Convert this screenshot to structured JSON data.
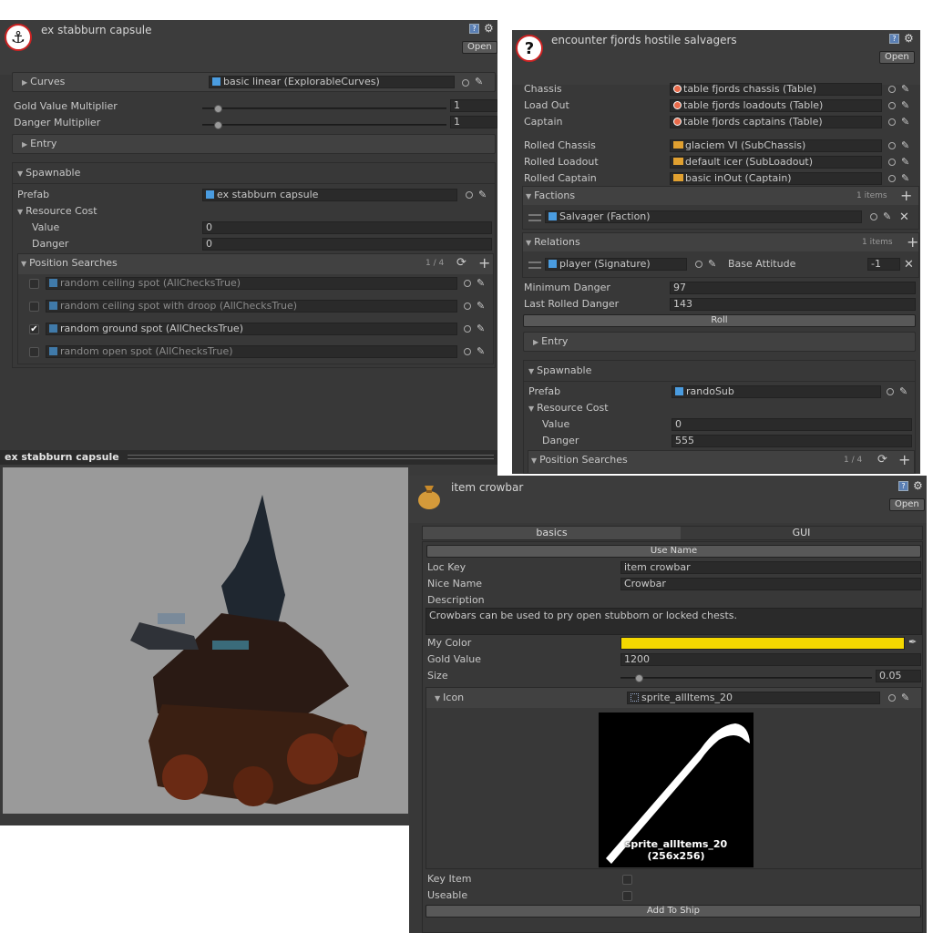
{
  "capsule_inspector": {
    "title": "ex stabburn capsule",
    "open_label": "Open",
    "curves": {
      "label": "Curves",
      "value": "basic linear (ExplorableCurves)"
    },
    "gold_multiplier": {
      "label": "Gold Value Multiplier",
      "value": "1",
      "slider_fraction": 0.05
    },
    "danger_multiplier": {
      "label": "Danger Multiplier",
      "value": "1",
      "slider_fraction": 0.05
    },
    "entry_label": "Entry",
    "spawnable_label": "Spawnable",
    "prefab": {
      "label": "Prefab",
      "value": "ex stabburn capsule"
    },
    "resource_cost_label": "Resource Cost",
    "value": {
      "label": "Value",
      "value": "0"
    },
    "danger": {
      "label": "Danger",
      "value": "0"
    },
    "position_searches": {
      "label": "Position Searches",
      "count": "1 / 4",
      "items": [
        {
          "text": "random ceiling spot (AllChecksTrue)",
          "checked": false
        },
        {
          "text": "random ceiling spot with droop (AllChecksTrue)",
          "checked": false
        },
        {
          "text": "random ground spot (AllChecksTrue)",
          "checked": true
        },
        {
          "text": "random open spot (AllChecksTrue)",
          "checked": false
        }
      ]
    }
  },
  "preview": {
    "title": "ex stabburn capsule"
  },
  "encounter_inspector": {
    "title": "encounter fjords hostile salvagers",
    "open_label": "Open",
    "chassis": {
      "label": "Chassis",
      "value": "table fjords chassis (Table)"
    },
    "load_out": {
      "label": "Load Out",
      "value": "table fjords loadouts (Table)"
    },
    "captain": {
      "label": "Captain",
      "value": "table fjords captains (Table)"
    },
    "rolled_chassis": {
      "label": "Rolled Chassis",
      "value": "glaciem VI (SubChassis)"
    },
    "rolled_loadout": {
      "label": "Rolled Loadout",
      "value": "default icer (SubLoadout)"
    },
    "rolled_captain": {
      "label": "Rolled Captain",
      "value": "basic inOut (Captain)"
    },
    "factions": {
      "label": "Factions",
      "count": "1 items",
      "item": "Salvager (Faction)"
    },
    "relations": {
      "label": "Relations",
      "count": "1 items",
      "item": "player (Signature)",
      "attitude_label": "Base Attitude",
      "attitude_value": "-1"
    },
    "min_danger": {
      "label": "Minimum Danger",
      "value": "97"
    },
    "last_danger": {
      "label": "Last Rolled Danger",
      "value": "143"
    },
    "roll_label": "Roll",
    "entry_label": "Entry",
    "spawnable_label": "Spawnable",
    "prefab": {
      "label": "Prefab",
      "value": "randoSub"
    },
    "resource_cost_label": "Resource Cost",
    "value": {
      "label": "Value",
      "value": "0"
    },
    "danger": {
      "label": "Danger",
      "value": "555"
    },
    "position_searches": {
      "label": "Position Searches",
      "count": "1 / 4"
    }
  },
  "item_inspector": {
    "title": "item crowbar",
    "open_label": "Open",
    "tabs": [
      "basics",
      "GUI"
    ],
    "use_name_label": "Use Name",
    "loc_key": {
      "label": "Loc Key",
      "value": "item crowbar"
    },
    "nice_name": {
      "label": "Nice Name",
      "value": "Crowbar"
    },
    "description": {
      "label": "Description",
      "value": "Crowbars can be used to pry open stubborn or locked chests."
    },
    "my_color": {
      "label": "My Color",
      "value": "#f5d800"
    },
    "gold_value": {
      "label": "Gold Value",
      "value": "1200"
    },
    "size": {
      "label": "Size",
      "value": "0.05",
      "slider_fraction": 0.06
    },
    "icon": {
      "label": "Icon",
      "value": "sprite_allItems_20",
      "caption1": "sprite_allItems_20",
      "caption2": "(256x256)"
    },
    "key_item_label": "Key Item",
    "useable_label": "Useable",
    "add_to_ship_label": "Add To Ship"
  }
}
